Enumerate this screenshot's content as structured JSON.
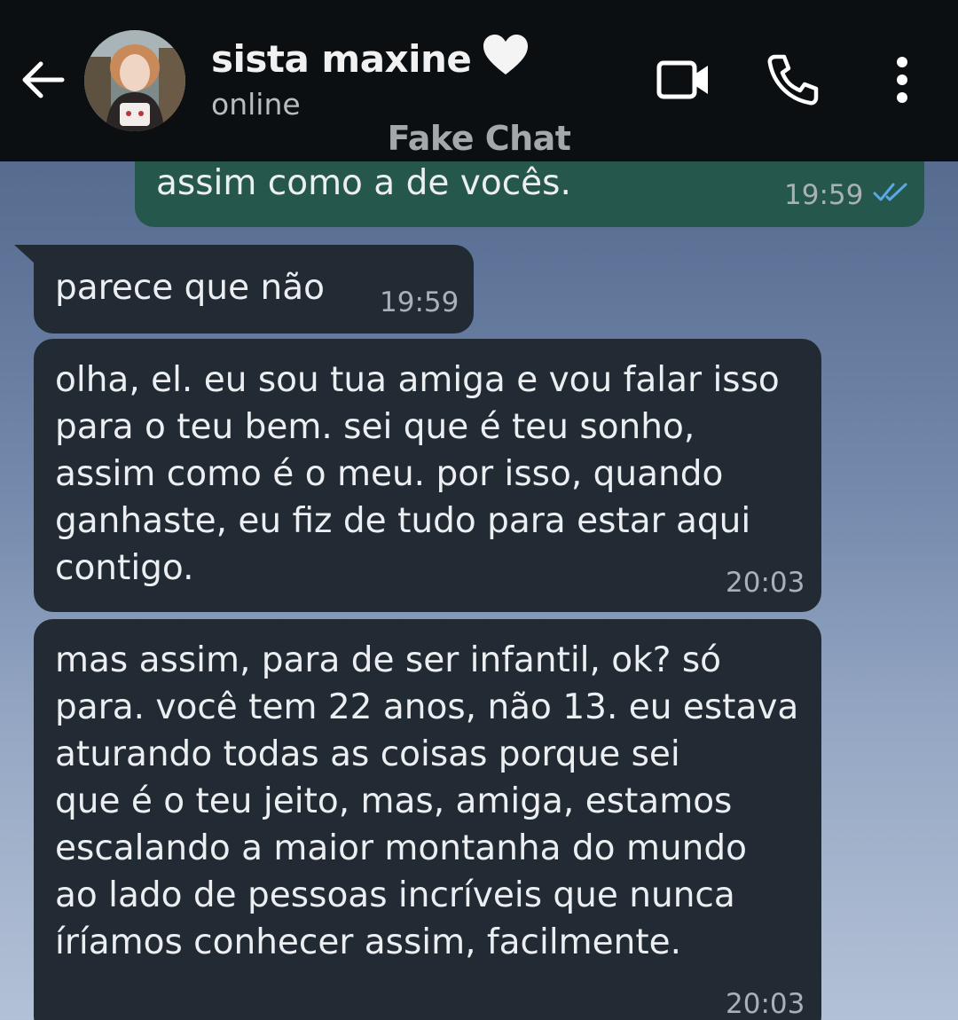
{
  "header": {
    "back_icon": "arrow-left-icon",
    "contact_name": "sista maxine",
    "name_emoji_icon": "white-heart-icon",
    "status": "online",
    "watermark": "Fake Chat",
    "video_icon": "video-camera-icon",
    "call_icon": "phone-icon",
    "menu_icon": "vertical-dots-icon"
  },
  "colors": {
    "header_bg": "#0b0f12",
    "outgoing_bubble": "#25574c",
    "incoming_bubble": "#222b33",
    "read_ticks": "#5aa9e6"
  },
  "messages": [
    {
      "direction": "outgoing",
      "text": "assim como a de vocês.",
      "time": "19:59",
      "status_icon": "double-check-read-icon"
    },
    {
      "direction": "incoming",
      "text": "parece que não",
      "time": "19:59"
    },
    {
      "direction": "incoming",
      "text": "olha, el. eu sou tua amiga e vou falar isso\npara o teu bem. sei que é teu sonho,\nassim como é o meu. por isso, quando\nganhaste, eu fiz de tudo para estar aqui\ncontigo.",
      "time": "20:03"
    },
    {
      "direction": "incoming",
      "text": "mas assim, para de ser infantil, ok? só\npara. você tem 22 anos, não 13. eu estava\naturando todas as coisas porque sei\nque é o teu jeito, mas, amiga, estamos\nescalando a maior montanha do mundo\nao lado de pessoas incríveis que nunca\níríamos conhecer assim, facilmente.",
      "time": "20:03"
    }
  ]
}
